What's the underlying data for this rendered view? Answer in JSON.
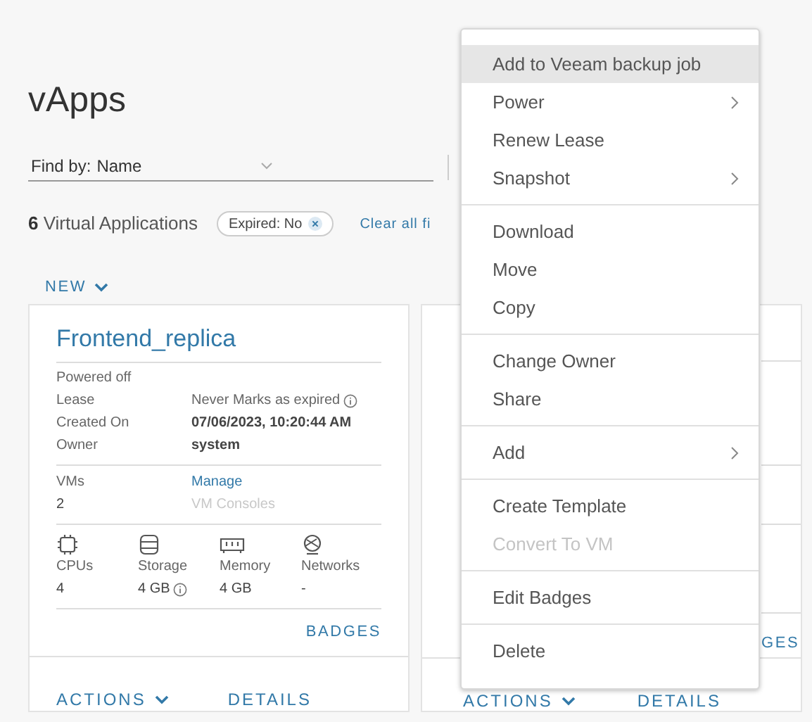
{
  "page": {
    "title": "vApps"
  },
  "find_by": {
    "label": "Find by:",
    "value": "Name"
  },
  "summary": {
    "count": "6",
    "label": "Virtual Applications"
  },
  "filter_chips": [
    {
      "label": "Expired: No"
    }
  ],
  "clear_filters": "Clear all fi",
  "new_button": "NEW",
  "cards": [
    {
      "title": "Frontend_replica",
      "status": "Powered off",
      "details": [
        {
          "label": "Lease",
          "value": "Never Marks as expired",
          "info": true,
          "bold": false
        },
        {
          "label": "Created On",
          "value": "07/06/2023, 10:20:44 AM",
          "info": false,
          "bold": true
        },
        {
          "label": "Owner",
          "value": "system",
          "info": false,
          "bold": true
        }
      ],
      "vms": {
        "label": "VMs",
        "value": "2",
        "links": [
          {
            "label": "Manage",
            "disabled": false
          },
          {
            "label": "VM Consoles",
            "disabled": true
          }
        ]
      },
      "resources": [
        {
          "kind": "cpu",
          "label": "CPUs",
          "value": "4",
          "info": false
        },
        {
          "kind": "storage",
          "label": "Storage",
          "value": "4 GB",
          "info": true
        },
        {
          "kind": "memory",
          "label": "Memory",
          "value": "4 GB",
          "info": false
        },
        {
          "kind": "network",
          "label": "Networks",
          "value": "-",
          "info": false
        }
      ],
      "badges": "BADGES",
      "actions": "ACTIONS",
      "details_link": "DETAILS"
    },
    {
      "badges": "GES",
      "actions": "ACTIONS",
      "details_link": "DETAILS"
    }
  ],
  "context_menu": {
    "groups": [
      [
        {
          "label": "Add to Veeam backup job",
          "selected": true,
          "disabled": false,
          "submenu": false
        },
        {
          "label": "Power",
          "selected": false,
          "disabled": false,
          "submenu": true
        },
        {
          "label": "Renew Lease",
          "selected": false,
          "disabled": false,
          "submenu": false
        },
        {
          "label": "Snapshot",
          "selected": false,
          "disabled": false,
          "submenu": true
        }
      ],
      [
        {
          "label": "Download",
          "selected": false,
          "disabled": false,
          "submenu": false
        },
        {
          "label": "Move",
          "selected": false,
          "disabled": false,
          "submenu": false
        },
        {
          "label": "Copy",
          "selected": false,
          "disabled": false,
          "submenu": false
        }
      ],
      [
        {
          "label": "Change Owner",
          "selected": false,
          "disabled": false,
          "submenu": false
        },
        {
          "label": "Share",
          "selected": false,
          "disabled": false,
          "submenu": false
        }
      ],
      [
        {
          "label": "Add",
          "selected": false,
          "disabled": false,
          "submenu": true
        }
      ],
      [
        {
          "label": "Create Template",
          "selected": false,
          "disabled": false,
          "submenu": false
        },
        {
          "label": "Convert To VM",
          "selected": false,
          "disabled": true,
          "submenu": false
        }
      ],
      [
        {
          "label": "Edit Badges",
          "selected": false,
          "disabled": false,
          "submenu": false
        }
      ],
      [
        {
          "label": "Delete",
          "selected": false,
          "disabled": false,
          "submenu": false
        }
      ]
    ]
  }
}
